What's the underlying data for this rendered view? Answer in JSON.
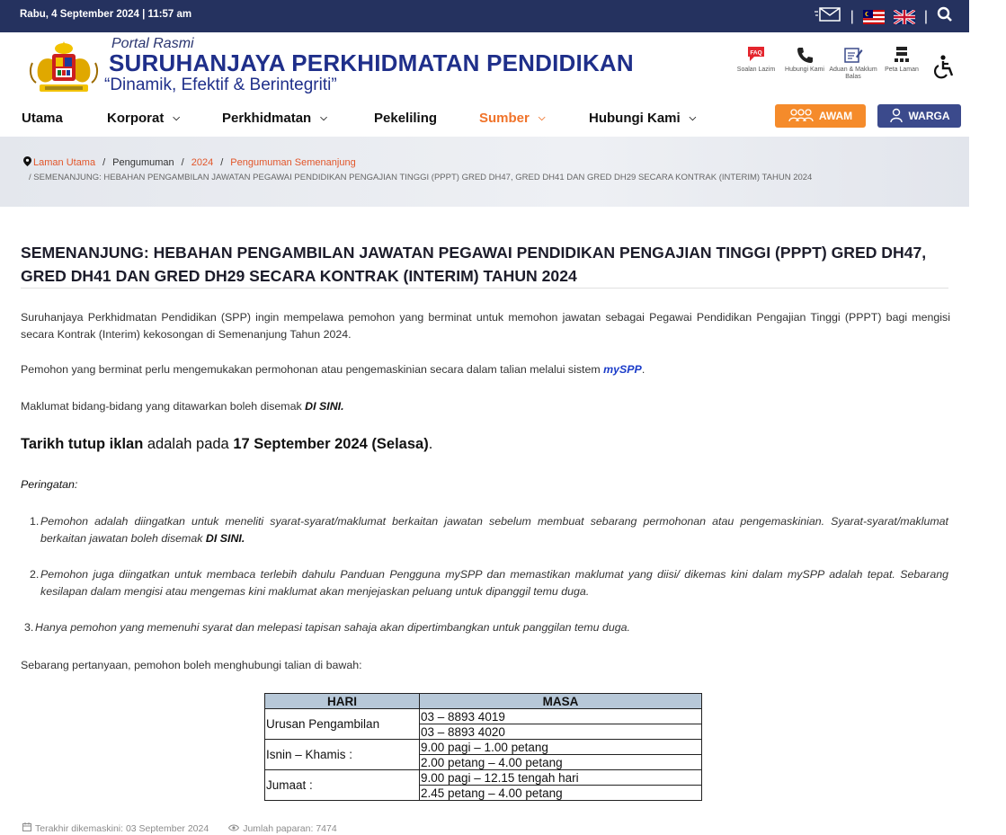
{
  "topbar": {
    "date": "Rabu, 4 September 2024 | 11:57 am"
  },
  "header": {
    "portal": "Portal Rasmi",
    "agency": "SURUHANJAYA PERKHIDMATAN PENDIDIKAN",
    "motto": "“Dinamik, Efektif & Berintegriti”",
    "quick_links": [
      {
        "label": "Soalan Lazim",
        "icon": "faq-icon"
      },
      {
        "label": "Hubungi Kami",
        "icon": "phone-icon"
      },
      {
        "label": "Aduan & Maklum Balas",
        "icon": "feedback-icon"
      },
      {
        "label": "Peta Laman",
        "icon": "sitemap-icon"
      }
    ]
  },
  "nav": {
    "items": [
      "Utama",
      "Korporat",
      "Perkhidmatan",
      "Pekeliling",
      "Sumber",
      "Hubungi Kami"
    ],
    "active": "Sumber",
    "awam": "AWAM",
    "warga": "WARGA"
  },
  "breadcrumb": {
    "home": "Laman Utama",
    "level1": "Pengumuman",
    "level2": "2024",
    "level3": "Pengumuman Semenanjung",
    "current": "/  SEMENANJUNG: HEBAHAN PENGAMBILAN JAWATAN PEGAWAI PENDIDIKAN PENGAJIAN TINGGI (PPPT) GRED DH47, GRED DH41 DAN GRED DH29 SECARA KONTRAK (INTERIM) TAHUN 2024"
  },
  "article": {
    "title": "SEMENANJUNG: HEBAHAN PENGAMBILAN JAWATAN PEGAWAI PENDIDIKAN PENGAJIAN TINGGI (PPPT) GRED DH47, GRED DH41 DAN GRED DH29 SECARA KONTRAK (INTERIM) TAHUN 2024",
    "p1": "Suruhanjaya Perkhidmatan Pendidikan (SPP) ingin mempelawa pemohon yang berminat untuk memohon jawatan sebagai Pegawai Pendidikan Pengajian Tinggi (PPPT) bagi mengisi secara Kontrak (Interim) kekosongan di Semenanjung Tahun 2024.",
    "p2_text": "Pemohon yang berminat perlu mengemukakan permohonan atau pengemaskinian secara dalam talian melalui sistem ",
    "p2_link": "mySPP",
    "p2_end": ".",
    "p3_text": "Maklumat bidang-bidang yang ditawarkan boleh disemak ",
    "p3_link": "DI SINI.",
    "closing_label": "Tarikh tutup iklan",
    "closing_mid": " adalah pada ",
    "closing_date": "17 September 2024 (Selasa)",
    "closing_end": ".",
    "warning_label": "Peringatan:",
    "list": [
      {
        "num": "1.",
        "text": "Pemohon adalah diingatkan untuk meneliti syarat-syarat/maklumat berkaitan jawatan sebelum membuat sebarang permohonan atau pengemaskinian. Syarat-syarat/maklumat berkaitan jawatan boleh disemak ",
        "link": "DI SINI."
      },
      {
        "num": "2.",
        "text": "Pemohon juga diingatkan untuk membaca terlebih dahulu Panduan Pengguna mySPP dan memastikan maklumat yang diisi/ dikemas kini dalam mySPP adalah tepat. Sebarang kesilapan dalam mengisi atau mengemas kini maklumat akan menjejaskan peluang untuk dipanggil temu duga."
      },
      {
        "num": "3.",
        "text": "Hanya pemohon yang memenuhi syarat dan melepasi tapisan sahaja akan dipertimbangkan untuk panggilan temu duga."
      }
    ],
    "contact_intro": "Sebarang pertanyaan, pemohon boleh menghubungi talian di bawah:",
    "table": {
      "headers": [
        "HARI",
        "MASA"
      ],
      "rows": [
        {
          "day": "Urusan Pengambilan",
          "times": [
            "03 – 8893 4019",
            "03 – 8893 4020"
          ]
        },
        {
          "day": "Isnin – Khamis :",
          "times": [
            "9.00 pagi – 1.00 petang",
            "2.00 petang – 4.00 petang"
          ]
        },
        {
          "day": "Jumaat :",
          "times": [
            "9.00 pagi – 12.15 tengah hari",
            "2.45 petang – 4.00 petang"
          ]
        }
      ]
    }
  },
  "footer": {
    "updated": "Terakhir dikemaskini: 03 September 2024",
    "views": "Jumlah paparan: 7474"
  },
  "colors": {
    "topbar": "#25325f",
    "brand": "#1f2f8a",
    "accent": "#f58b2b",
    "link": "#1b3cc9",
    "warga": "#3b4a8c"
  }
}
